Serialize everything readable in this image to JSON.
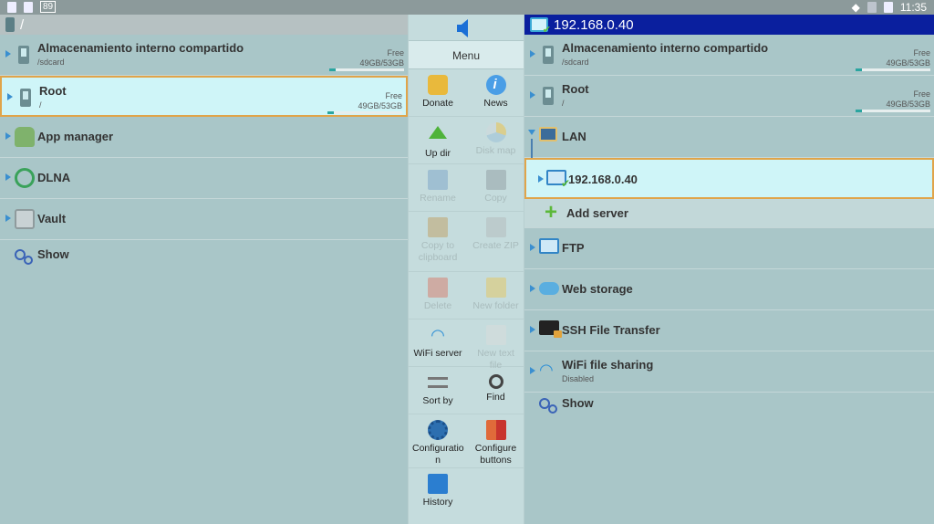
{
  "statusbar": {
    "badge": "89",
    "time": "11:35"
  },
  "left": {
    "path": "/",
    "items": [
      {
        "title": "Almacenamiento interno compartido",
        "sub": "/sdcard",
        "free_label": "Free",
        "capacity": "49GB/53GB",
        "usage": 0.08
      },
      {
        "title": "Root",
        "sub": "/",
        "free_label": "Free",
        "capacity": "49GB/53GB",
        "usage": 0.08
      },
      {
        "title": "App manager"
      },
      {
        "title": "DLNA"
      },
      {
        "title": "Vault"
      },
      {
        "title": "Show"
      }
    ]
  },
  "menu": {
    "title": "Menu",
    "items": [
      {
        "label": "Donate",
        "icon": "donate-icon"
      },
      {
        "label": "News",
        "icon": "news-icon"
      },
      {
        "label": "Up dir",
        "icon": "up-dir-icon"
      },
      {
        "label": "Disk map",
        "icon": "disk-map-icon"
      },
      {
        "label": "Rename",
        "icon": "rename-icon"
      },
      {
        "label": "Copy",
        "icon": "copy-icon"
      },
      {
        "label": "Copy to clipboard",
        "icon": "clipboard-icon"
      },
      {
        "label": "Create ZIP",
        "icon": "zip-icon"
      },
      {
        "label": "Delete",
        "icon": "trash-icon"
      },
      {
        "label": "New folder",
        "icon": "new-folder-icon"
      },
      {
        "label": "WiFi server",
        "icon": "wifi-icon"
      },
      {
        "label": "New text file",
        "icon": "new-text-file-icon"
      },
      {
        "label": "Sort by",
        "icon": "sort-icon"
      },
      {
        "label": "Find",
        "icon": "search-icon"
      },
      {
        "label": "Configuratio n",
        "icon": "gear-icon"
      },
      {
        "label": "Configure buttons",
        "icon": "configure-buttons-icon"
      },
      {
        "label": "History",
        "icon": "history-icon"
      }
    ]
  },
  "right": {
    "path": "192.168.0.40",
    "items": [
      {
        "title": "Almacenamiento interno compartido",
        "sub": "/sdcard",
        "free_label": "Free",
        "capacity": "49GB/53GB",
        "usage": 0.08
      },
      {
        "title": "Root",
        "sub": "/",
        "free_label": "Free",
        "capacity": "49GB/53GB",
        "usage": 0.08
      },
      {
        "title": "LAN"
      },
      {
        "title": "192.168.0.40"
      },
      {
        "title": "Add server"
      },
      {
        "title": "FTP"
      },
      {
        "title": "Web storage"
      },
      {
        "title": "SSH File Transfer"
      },
      {
        "title": "WiFi file sharing",
        "sub": "Disabled"
      },
      {
        "title": "Show"
      }
    ]
  },
  "colors": {
    "background": "#a9c6c8",
    "active_path": "#0a1f9e",
    "selection": "#cff5f8",
    "selection_border": "#e0a44a"
  }
}
